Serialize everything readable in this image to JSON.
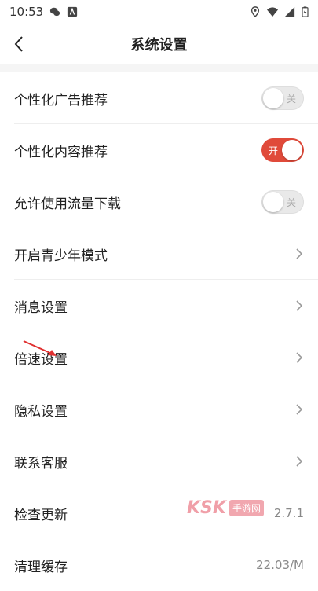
{
  "status_bar": {
    "time": "10:53"
  },
  "header": {
    "title": "系统设置"
  },
  "rows": [
    {
      "label": "个性化广告推荐",
      "control": "toggle",
      "state": "off",
      "toggle_text": "关"
    },
    {
      "label": "个性化内容推荐",
      "control": "toggle",
      "state": "on",
      "toggle_text": "开"
    },
    {
      "label": "允许使用流量下载",
      "control": "toggle",
      "state": "off",
      "toggle_text": "关"
    },
    {
      "label": "开启青少年模式",
      "control": "chevron"
    },
    {
      "label": "消息设置",
      "control": "chevron"
    },
    {
      "label": "倍速设置",
      "control": "chevron"
    },
    {
      "label": "隐私设置",
      "control": "chevron"
    },
    {
      "label": "联系客服",
      "control": "chevron"
    },
    {
      "label": "检查更新",
      "control": "value",
      "value": "2.7.1"
    },
    {
      "label": "清理缓存",
      "control": "value",
      "value": "22.03/M"
    }
  ],
  "watermark": {
    "text": "KSK",
    "badge": "手游网"
  },
  "colors": {
    "accent": "#e04a3a",
    "annotation_arrow": "#e03030"
  }
}
